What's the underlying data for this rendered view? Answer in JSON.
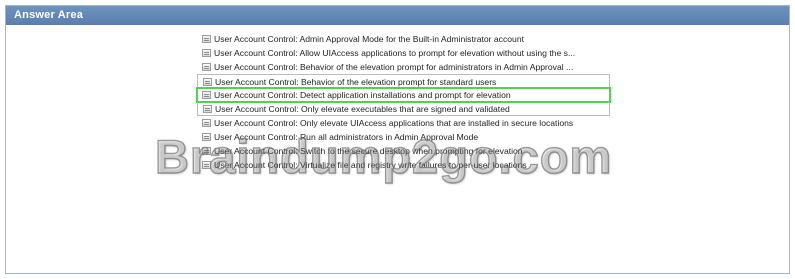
{
  "panel": {
    "title": "Answer Area"
  },
  "policies": [
    {
      "label": "User Account Control: Admin Approval Mode for the Built-in Administrator account"
    },
    {
      "label": "User Account Control: Allow UIAccess applications to prompt for elevation without using the s..."
    },
    {
      "label": "User Account Control: Behavior of the elevation prompt for administrators in Admin Approval ..."
    },
    {
      "label": "User Account Control: Behavior of the elevation prompt for standard users"
    },
    {
      "label": "User Account Control: Detect application installations and prompt for elevation",
      "selected": true
    },
    {
      "label": "User Account Control: Only elevate executables that are signed and validated"
    },
    {
      "label": "User Account Control: Only elevate UIAccess applications that are installed in secure locations"
    },
    {
      "label": "User Account Control: Run all administrators in Admin Approval Mode"
    },
    {
      "label": "User Account Control: Switch to the secure desktop when prompting for elevation"
    },
    {
      "label": "User Account Control: Virtualize file and registry write failures to per-user locations"
    }
  ],
  "watermark": "Braindump2go.com",
  "colors": {
    "header": "#5b7fad",
    "selection_outline": "#4fd24f"
  }
}
